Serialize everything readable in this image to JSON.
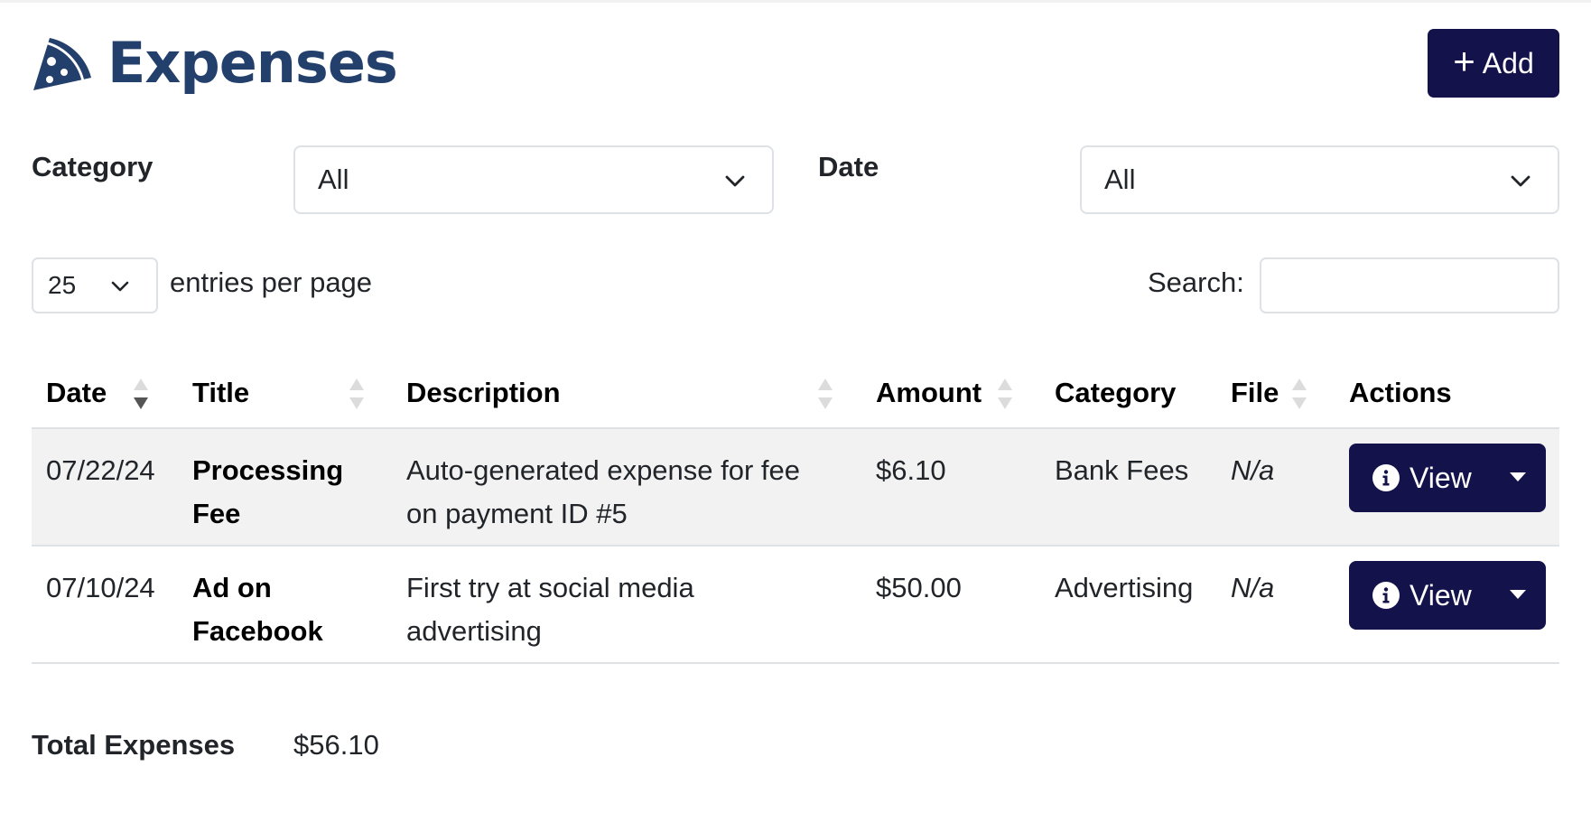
{
  "header": {
    "title": "Expenses",
    "add_label": "Add",
    "brand_color": "#233f6b",
    "button_color": "#14124b"
  },
  "filters": {
    "category_label": "Category",
    "category_value": "All",
    "date_label": "Date",
    "date_value": "All"
  },
  "table_controls": {
    "entries_value": "25",
    "entries_text": "entries per page",
    "search_label": "Search:",
    "search_value": ""
  },
  "table": {
    "columns": [
      "Date",
      "Title",
      "Description",
      "Amount",
      "Category",
      "File",
      "Actions"
    ],
    "rows": [
      {
        "date": "07/22/24",
        "title_line1": "Processing",
        "title_line2": "Fee",
        "desc_line1": "Auto-generated expense for fee",
        "desc_line2": "on payment ID #5",
        "amount": "$6.10",
        "category": "Bank Fees",
        "file": "N/a",
        "action": "View"
      },
      {
        "date": "07/10/24",
        "title_line1": "Ad on",
        "title_line2": "Facebook",
        "desc_line1": "First try at social media",
        "desc_line2": "advertising",
        "amount": "$50.00",
        "category": "Advertising",
        "file": "N/a",
        "action": "View"
      }
    ]
  },
  "totals": {
    "label": "Total Expenses",
    "value": "$56.10"
  },
  "icons": {
    "brand": "pizza-slice-icon",
    "add": "plus-icon",
    "select": "chevron-down-icon",
    "sort": "sort-icon",
    "info": "info-circle-icon",
    "dropdown": "caret-down-icon"
  }
}
